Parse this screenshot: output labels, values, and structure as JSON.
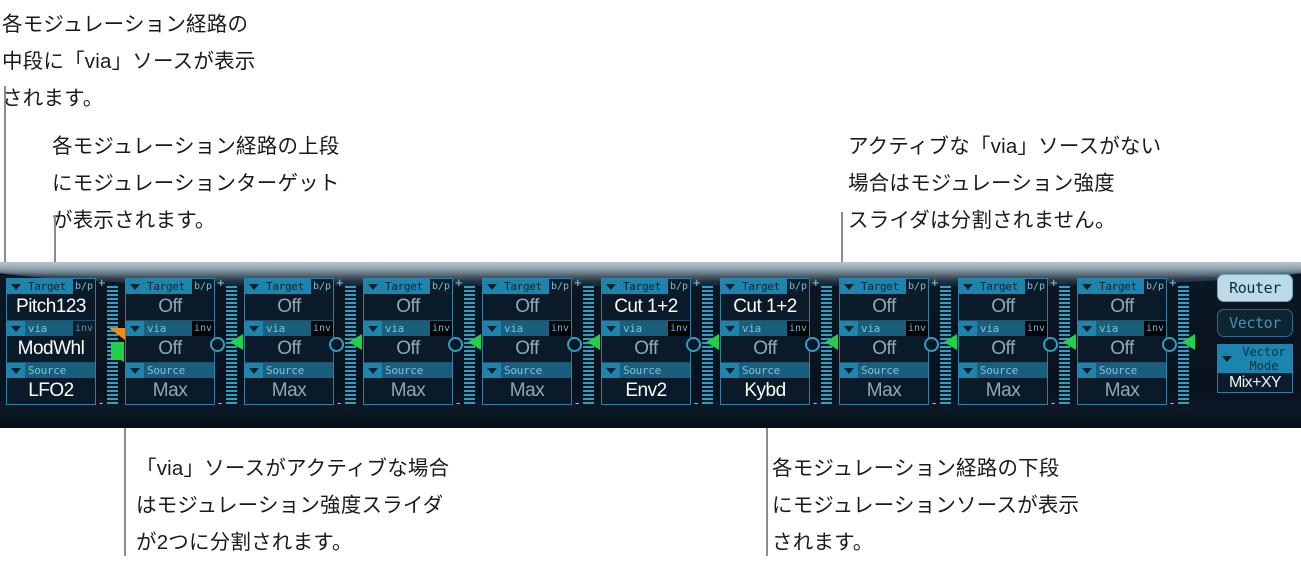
{
  "annotations": [
    {
      "id": "via-middle",
      "text": "各モジュレーション経路の\n中段に「via」ソースが表示\nされます。"
    },
    {
      "id": "target-top",
      "text": "各モジュレーション経路の上段\nにモジュレーションターゲット\nが表示されます。"
    },
    {
      "id": "no-active-via",
      "text": "アクティブな「via」ソースがない\n場合はモジュレーション強度\nスライダは分割されません。"
    },
    {
      "id": "active-via",
      "text": "「via」ソースがアクティブな場合\nはモジュレーション強度スライダ\nが2つに分割されます。"
    },
    {
      "id": "source-bottom",
      "text": "各モジュレーション経路の下段\nにモジュレーションソースが表示\nされます。"
    }
  ],
  "panel": {
    "row_labels": {
      "target": "Target",
      "via": "via",
      "source": "Source"
    },
    "tags": {
      "bypass": "b/p",
      "invert": "inv",
      "plus": "+",
      "minus": "-"
    },
    "slots": [
      {
        "target": "Pitch123",
        "via": "ModWhl",
        "source": "LFO2",
        "via_active": true,
        "split_slider": true,
        "invert_on": false
      },
      {
        "target": "Off",
        "via": "Off",
        "source": "Max",
        "via_active": false,
        "split_slider": false,
        "invert_on": true
      },
      {
        "target": "Off",
        "via": "Off",
        "source": "Max",
        "via_active": false,
        "split_slider": false,
        "invert_on": true
      },
      {
        "target": "Off",
        "via": "Off",
        "source": "Max",
        "via_active": false,
        "split_slider": false,
        "invert_on": true
      },
      {
        "target": "Off",
        "via": "Off",
        "source": "Max",
        "via_active": false,
        "split_slider": false,
        "invert_on": true
      },
      {
        "target": "Cut 1+2",
        "via": "Off",
        "source": "Env2",
        "via_active": false,
        "split_slider": false,
        "invert_on": true
      },
      {
        "target": "Cut 1+2",
        "via": "Off",
        "source": "Kybd",
        "via_active": false,
        "split_slider": false,
        "invert_on": true
      },
      {
        "target": "Off",
        "via": "Off",
        "source": "Max",
        "via_active": false,
        "split_slider": false,
        "invert_on": true
      },
      {
        "target": "Off",
        "via": "Off",
        "source": "Max",
        "via_active": false,
        "split_slider": false,
        "invert_on": true
      },
      {
        "target": "Off",
        "via": "Off",
        "source": "Max",
        "via_active": false,
        "split_slider": false,
        "invert_on": true
      }
    ],
    "controls": {
      "router_label": "Router",
      "vector_label": "Vector",
      "vector_mode_label": "Vector\nMode",
      "vector_mode_value": "Mix+XY"
    }
  },
  "colors": {
    "panel_bg": "#0a1420",
    "accent_cyan": "#1b85ae",
    "slider_green": "#22d14a",
    "slider_orange": "#f08a1e",
    "active_button": "#bcdbe9"
  }
}
